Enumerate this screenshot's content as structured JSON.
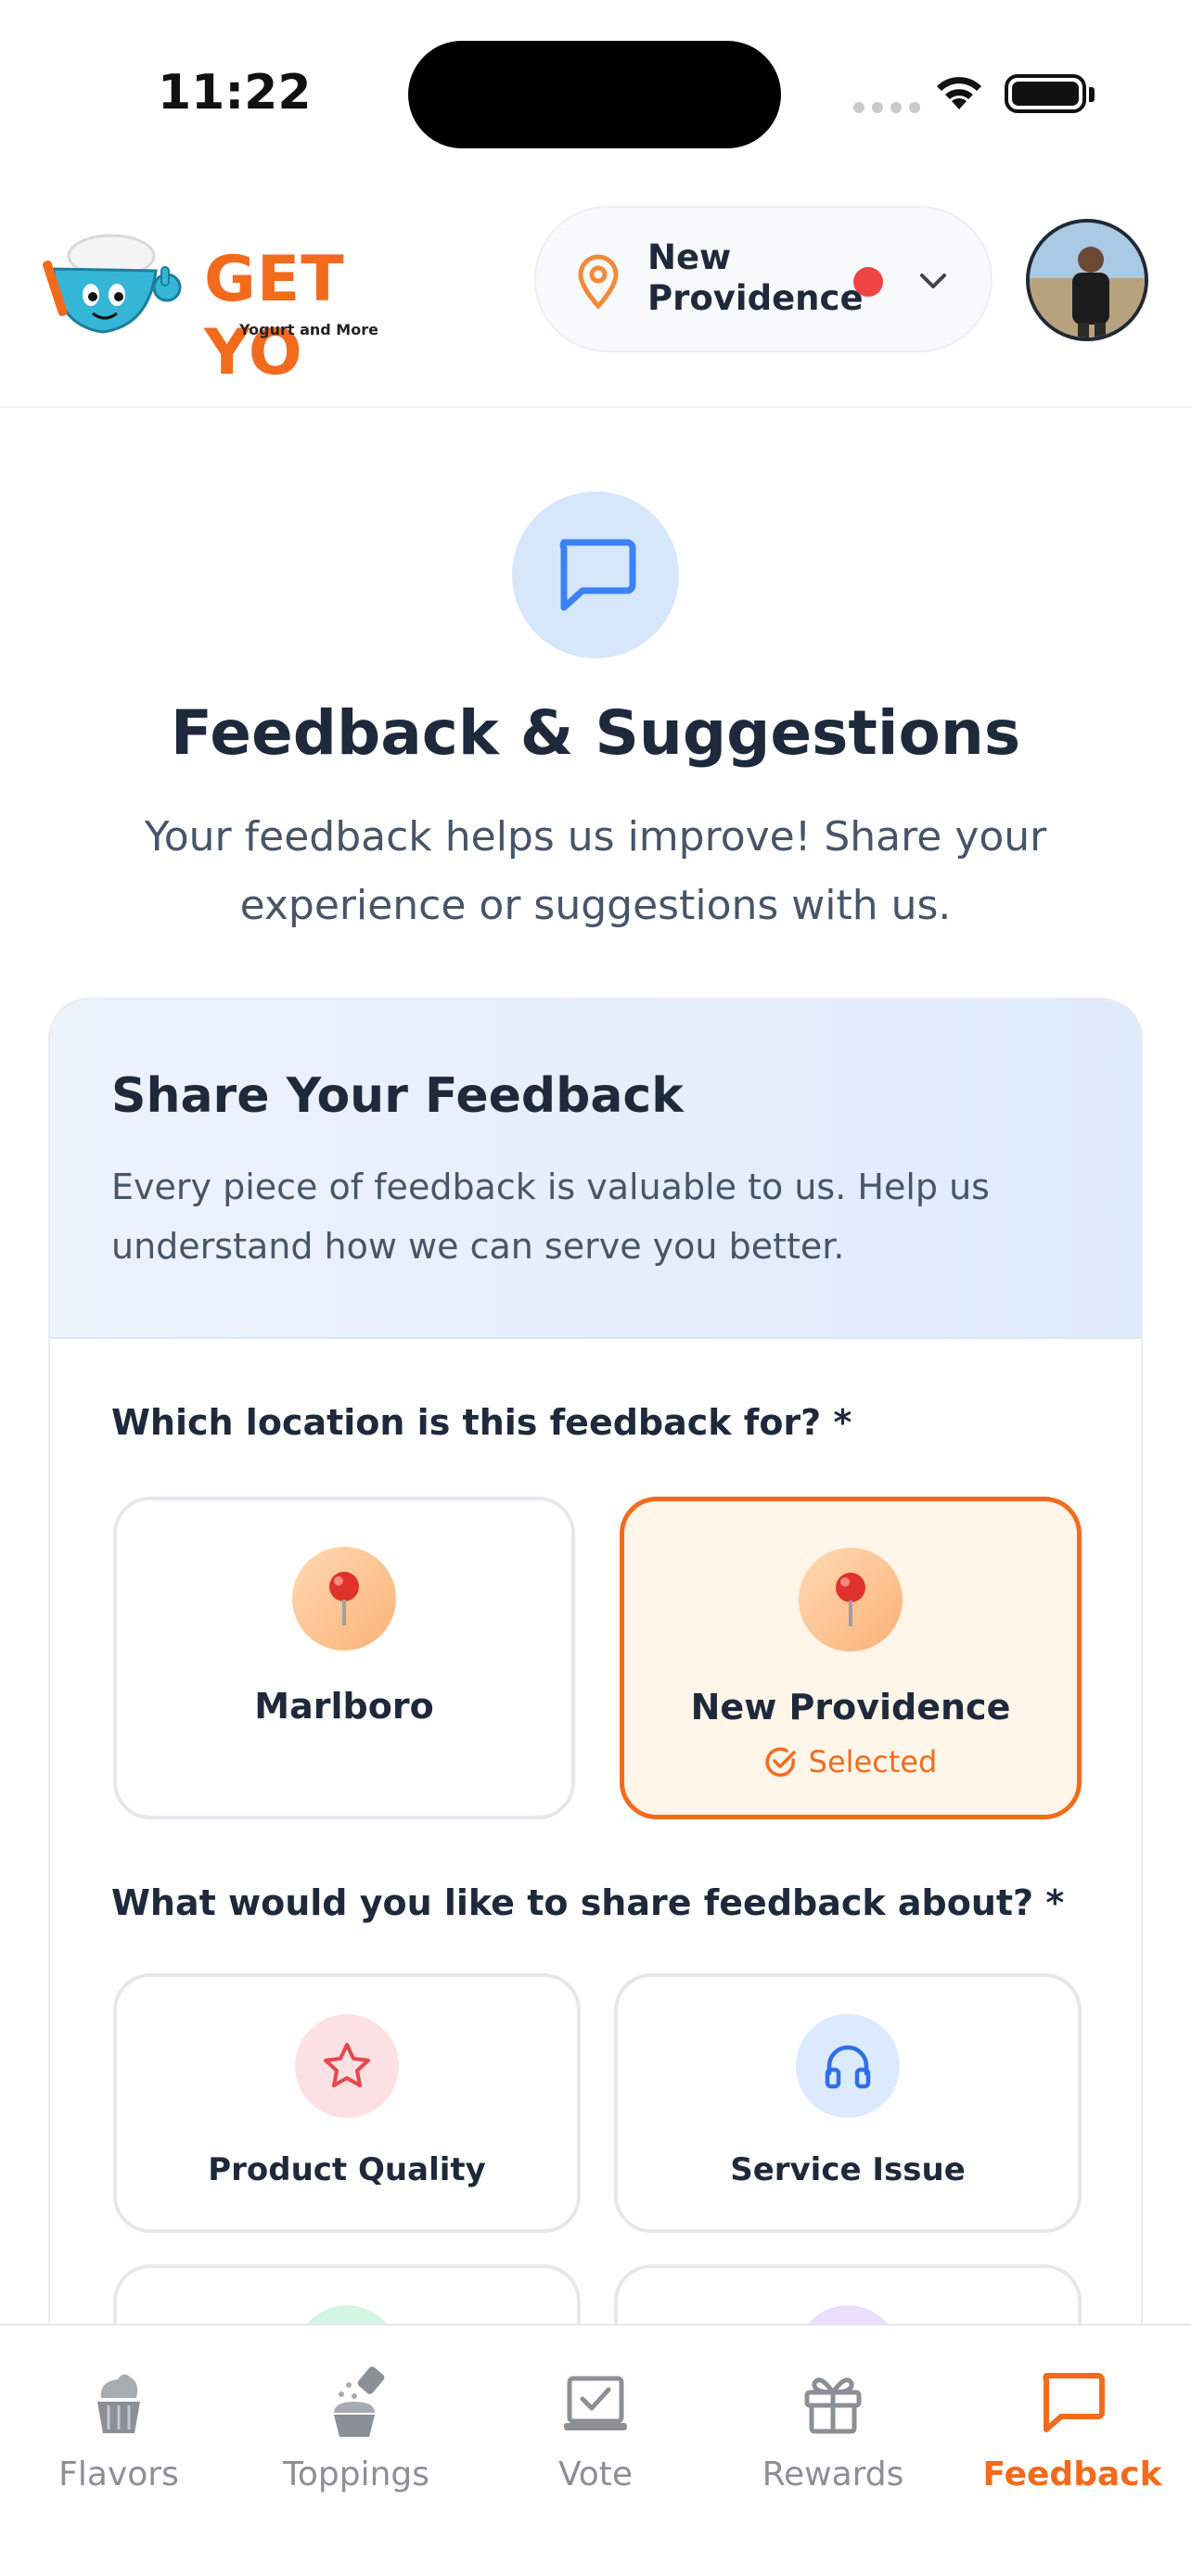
{
  "status_bar": {
    "time": "11:22"
  },
  "header": {
    "logo_text": "GET YO",
    "logo_subtitle": "Yogurt and More",
    "location": "New Providence"
  },
  "intro": {
    "title": "Feedback & Suggestions",
    "subtitle": "Your feedback helps us improve! Share your experience or suggestions with us."
  },
  "feedback_card": {
    "title": "Share Your Feedback",
    "description": "Every piece of feedback is valuable to us. Help us understand how we can serve you better.",
    "location_question": "Which location is this feedback for? *",
    "locations": [
      {
        "name": "Marlboro",
        "icon": "pushpin-icon",
        "selected": false
      },
      {
        "name": "New Providence",
        "icon": "pushpin-icon",
        "selected": true,
        "selected_label": "Selected"
      }
    ],
    "topic_question": "What would you like to share feedback about? *",
    "topics": [
      {
        "name": "Product Quality",
        "icon": "star-icon",
        "icon_color": "#e5484d"
      },
      {
        "name": "Service Issue",
        "icon": "headphones-icon",
        "icon_color": "#2f6fe4"
      }
    ]
  },
  "tab_bar": {
    "tabs": [
      {
        "label": "Flavors",
        "icon": "cupcake-icon",
        "active": false
      },
      {
        "label": "Toppings",
        "icon": "sprinkles-icon",
        "active": false
      },
      {
        "label": "Vote",
        "icon": "ballot-icon",
        "active": false
      },
      {
        "label": "Rewards",
        "icon": "gift-icon",
        "active": false
      },
      {
        "label": "Feedback",
        "icon": "message-square-icon",
        "active": true
      }
    ]
  },
  "colors": {
    "accent": "#f26b1d",
    "primary_text": "#1e293b",
    "status_dot": "#ef4444",
    "info_blue": "#2f6fe4"
  }
}
